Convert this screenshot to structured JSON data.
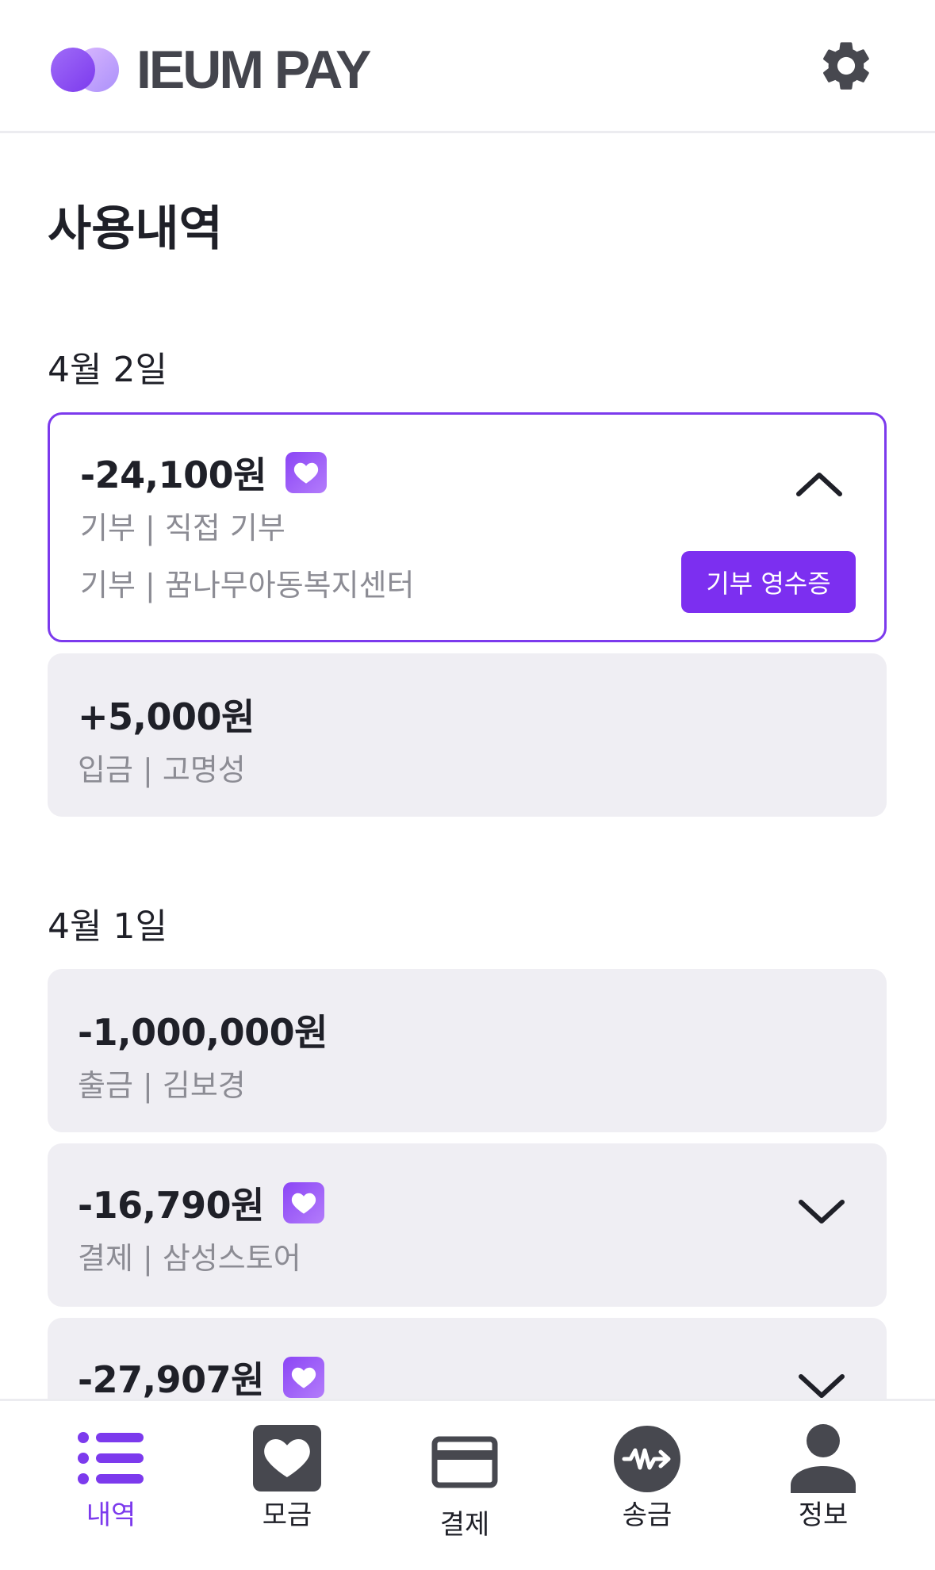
{
  "header": {
    "app_name": "IEUM PAY",
    "settings_icon": "gear-icon"
  },
  "page_title": "사용내역",
  "groups": [
    {
      "date": "4월 2일",
      "items": [
        {
          "amount": "-24,100원",
          "donation_badge": true,
          "line1": "기부 | 직접 기부",
          "line2": "기부 | 꿈나무아동복지센터",
          "button": "기부 영수증",
          "expanded": true
        },
        {
          "amount": "+5,000원",
          "donation_badge": false,
          "line1": "입금 | 고명성"
        }
      ]
    },
    {
      "date": "4월 1일",
      "items": [
        {
          "amount": "-1,000,000원",
          "donation_badge": false,
          "line1": "출금 | 김보경"
        },
        {
          "amount": "-16,790원",
          "donation_badge": true,
          "line1": "결제 | 삼성스토어",
          "expanded": false
        },
        {
          "amount": "-27,907원",
          "donation_badge": true,
          "expanded": false
        }
      ]
    }
  ],
  "tabbar": {
    "tabs": [
      {
        "label": "내역",
        "icon": "list-icon",
        "active": true
      },
      {
        "label": "모금",
        "icon": "heart-icon",
        "active": false
      },
      {
        "label": "결제",
        "icon": "card-icon",
        "active": false
      },
      {
        "label": "송금",
        "icon": "won-transfer-icon",
        "active": false
      },
      {
        "label": "정보",
        "icon": "person-icon",
        "active": false
      }
    ]
  },
  "colors": {
    "accent": "#7c3aed",
    "card_bg": "#efeef3",
    "text": "#1f2028",
    "sub_text": "#8c8c94"
  }
}
